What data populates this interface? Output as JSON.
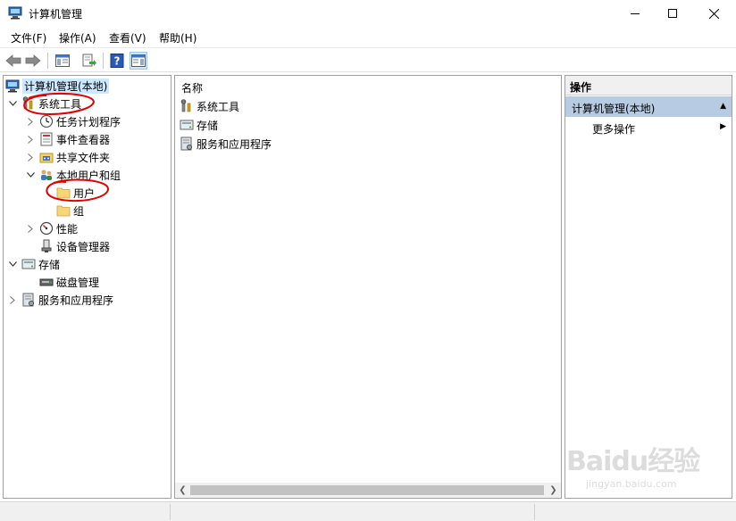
{
  "window": {
    "title": "计算机管理"
  },
  "menu": [
    "文件(F)",
    "操作(A)",
    "查看(V)",
    "帮助(H)"
  ],
  "tree": {
    "root": "计算机管理(本地)",
    "system_tools": "系统工具",
    "task_scheduler": "任务计划程序",
    "event_viewer": "事件查看器",
    "shared_folders": "共享文件夹",
    "local_users_groups": "本地用户和组",
    "users": "用户",
    "groups": "组",
    "performance": "性能",
    "device_manager": "设备管理器",
    "storage": "存储",
    "disk_management": "磁盘管理",
    "services_apps": "服务和应用程序"
  },
  "list": {
    "column_name": "名称",
    "items": [
      "系统工具",
      "存储",
      "服务和应用程序"
    ]
  },
  "actions": {
    "header": "操作",
    "group": "计算机管理(本地)",
    "more": "更多操作"
  },
  "watermark": {
    "brand": "Baidu经验",
    "url": "jingyan.baidu.com"
  },
  "colors": {
    "selection": "#cce8ff",
    "action_group_bg": "#b7cbe2",
    "annotation": "#e00000"
  }
}
